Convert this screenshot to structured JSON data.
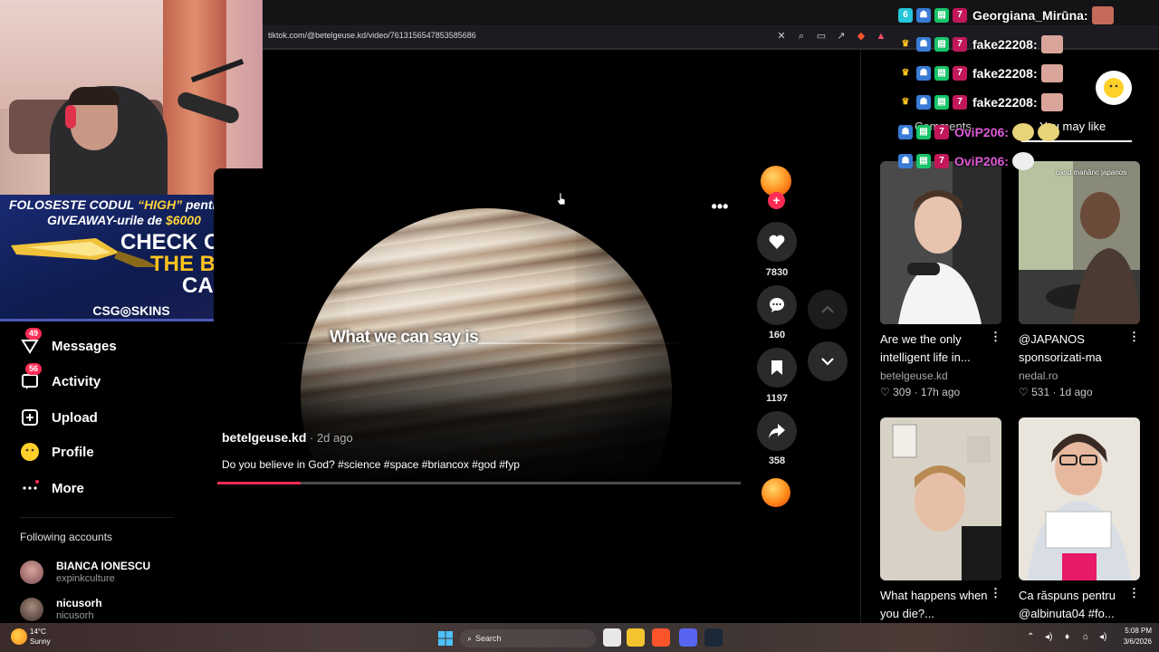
{
  "browser": {
    "url": "tiktok.com/@betelgeuse.kd/video/7613156547853585686"
  },
  "stream_overlay": {
    "promo_line1_prefix": "FOLOSESTE CODUL ",
    "promo_code": "“HIGH”",
    "promo_line1_suffix": " pentru",
    "promo_line2_prefix": "GIVEAWAY-urile de ",
    "promo_amount": "$6000",
    "promo_check": "CHECK OUT",
    "promo_best": "THE BEST",
    "promo_cases": "CASES",
    "promo_brand": "CSG◎SKINS"
  },
  "sidebar": {
    "items": [
      {
        "label": "Messages",
        "badge": "49",
        "icon": "messages-icon"
      },
      {
        "label": "Activity",
        "badge": "56",
        "icon": "activity-icon"
      },
      {
        "label": "Upload",
        "badge": "",
        "icon": "upload-icon"
      },
      {
        "label": "Profile",
        "badge": "",
        "icon": "profile-avatar"
      },
      {
        "label": "More",
        "badge": "",
        "icon": "more-icon"
      }
    ],
    "following_title": "Following accounts",
    "following": [
      {
        "name": "BIANCA IONESCU",
        "handle": "expinkculture"
      },
      {
        "name": "nicusorh",
        "handle": "nicusorh"
      }
    ]
  },
  "video": {
    "caption": "What we can say is",
    "author": "betelgeuse.kd",
    "separator": " · ",
    "posted": "2d ago",
    "description": "Do you believe in God? #science #space #briancox #god #fyp",
    "more": "•••",
    "progress_fraction": 0.16
  },
  "actions": {
    "likes": "7830",
    "comments": "160",
    "saves": "1197",
    "shares": "358",
    "follow_symbol": "+"
  },
  "right_panel": {
    "tabs": [
      "Comments",
      "You may like"
    ],
    "active_tab": "You may like",
    "recommendations": [
      {
        "title": "Are we the only intelligent life in...",
        "author": "betelgeuse.kd",
        "likes": "309",
        "age": "17h ago"
      },
      {
        "title": "@JAPANOS sponsorizati-ma",
        "author": "nedal.ro",
        "likes": "531",
        "age": "1d ago"
      },
      {
        "title": "What happens when you die?...",
        "author": "",
        "likes": "",
        "age": ""
      },
      {
        "title": "Ca răspuns pentru @albinuta04 #fo...",
        "author": "",
        "likes": "",
        "age": ""
      }
    ],
    "thumb2_caption": "când manânc japanos",
    "meta_separator": " · "
  },
  "chat": [
    {
      "name": "Georgiana_Mirūna:",
      "color": "#ffffff"
    },
    {
      "name": "fake22208:",
      "color": "#ffffff"
    },
    {
      "name": "fake22208:",
      "color": "#ffffff"
    },
    {
      "name": "fake22208:",
      "color": "#ffffff"
    },
    {
      "name": "OviP206:",
      "color": "#e05ad8"
    },
    {
      "name": "OviP206:",
      "color": "#e05ad8"
    }
  ],
  "taskbar": {
    "temp": "14°C",
    "weather": "Sunny",
    "search": "Search",
    "time": "5:08 PM",
    "date": "3/6/2026"
  },
  "colors": {
    "accent": "#fe2c55",
    "promo_yellow": "#ffd23d",
    "chat_purple": "#e05ad8"
  }
}
